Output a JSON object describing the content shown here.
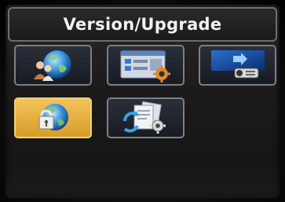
{
  "header": {
    "title": "Version/Upgrade"
  },
  "menu": {
    "selected_index": 3,
    "items": [
      {
        "icon": "globe-people-icon"
      },
      {
        "icon": "settings-panel-gear-icon"
      },
      {
        "icon": "projector-icon"
      },
      {
        "icon": "globe-lock-icon"
      },
      {
        "icon": "document-refresh-gear-icon"
      }
    ]
  },
  "colors": {
    "selected_tile": "#e8b345",
    "tile_border": "#7d7f86",
    "title_text": "#f2f2f2"
  }
}
